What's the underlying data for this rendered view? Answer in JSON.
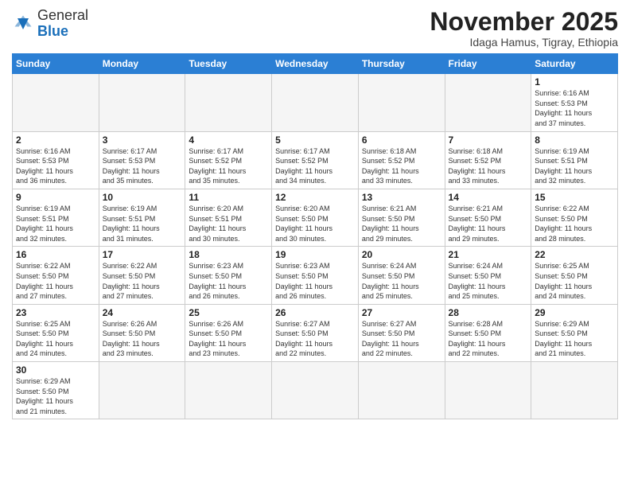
{
  "header": {
    "logo_general": "General",
    "logo_blue": "Blue",
    "month_title": "November 2025",
    "location": "Idaga Hamus, Tigray, Ethiopia"
  },
  "days_of_week": [
    "Sunday",
    "Monday",
    "Tuesday",
    "Wednesday",
    "Thursday",
    "Friday",
    "Saturday"
  ],
  "weeks": [
    [
      {
        "day": "",
        "info": ""
      },
      {
        "day": "",
        "info": ""
      },
      {
        "day": "",
        "info": ""
      },
      {
        "day": "",
        "info": ""
      },
      {
        "day": "",
        "info": ""
      },
      {
        "day": "",
        "info": ""
      },
      {
        "day": "1",
        "info": "Sunrise: 6:16 AM\nSunset: 5:53 PM\nDaylight: 11 hours\nand 37 minutes."
      }
    ],
    [
      {
        "day": "2",
        "info": "Sunrise: 6:16 AM\nSunset: 5:53 PM\nDaylight: 11 hours\nand 36 minutes."
      },
      {
        "day": "3",
        "info": "Sunrise: 6:17 AM\nSunset: 5:53 PM\nDaylight: 11 hours\nand 35 minutes."
      },
      {
        "day": "4",
        "info": "Sunrise: 6:17 AM\nSunset: 5:52 PM\nDaylight: 11 hours\nand 35 minutes."
      },
      {
        "day": "5",
        "info": "Sunrise: 6:17 AM\nSunset: 5:52 PM\nDaylight: 11 hours\nand 34 minutes."
      },
      {
        "day": "6",
        "info": "Sunrise: 6:18 AM\nSunset: 5:52 PM\nDaylight: 11 hours\nand 33 minutes."
      },
      {
        "day": "7",
        "info": "Sunrise: 6:18 AM\nSunset: 5:52 PM\nDaylight: 11 hours\nand 33 minutes."
      },
      {
        "day": "8",
        "info": "Sunrise: 6:19 AM\nSunset: 5:51 PM\nDaylight: 11 hours\nand 32 minutes."
      }
    ],
    [
      {
        "day": "9",
        "info": "Sunrise: 6:19 AM\nSunset: 5:51 PM\nDaylight: 11 hours\nand 32 minutes."
      },
      {
        "day": "10",
        "info": "Sunrise: 6:19 AM\nSunset: 5:51 PM\nDaylight: 11 hours\nand 31 minutes."
      },
      {
        "day": "11",
        "info": "Sunrise: 6:20 AM\nSunset: 5:51 PM\nDaylight: 11 hours\nand 30 minutes."
      },
      {
        "day": "12",
        "info": "Sunrise: 6:20 AM\nSunset: 5:50 PM\nDaylight: 11 hours\nand 30 minutes."
      },
      {
        "day": "13",
        "info": "Sunrise: 6:21 AM\nSunset: 5:50 PM\nDaylight: 11 hours\nand 29 minutes."
      },
      {
        "day": "14",
        "info": "Sunrise: 6:21 AM\nSunset: 5:50 PM\nDaylight: 11 hours\nand 29 minutes."
      },
      {
        "day": "15",
        "info": "Sunrise: 6:22 AM\nSunset: 5:50 PM\nDaylight: 11 hours\nand 28 minutes."
      }
    ],
    [
      {
        "day": "16",
        "info": "Sunrise: 6:22 AM\nSunset: 5:50 PM\nDaylight: 11 hours\nand 27 minutes."
      },
      {
        "day": "17",
        "info": "Sunrise: 6:22 AM\nSunset: 5:50 PM\nDaylight: 11 hours\nand 27 minutes."
      },
      {
        "day": "18",
        "info": "Sunrise: 6:23 AM\nSunset: 5:50 PM\nDaylight: 11 hours\nand 26 minutes."
      },
      {
        "day": "19",
        "info": "Sunrise: 6:23 AM\nSunset: 5:50 PM\nDaylight: 11 hours\nand 26 minutes."
      },
      {
        "day": "20",
        "info": "Sunrise: 6:24 AM\nSunset: 5:50 PM\nDaylight: 11 hours\nand 25 minutes."
      },
      {
        "day": "21",
        "info": "Sunrise: 6:24 AM\nSunset: 5:50 PM\nDaylight: 11 hours\nand 25 minutes."
      },
      {
        "day": "22",
        "info": "Sunrise: 6:25 AM\nSunset: 5:50 PM\nDaylight: 11 hours\nand 24 minutes."
      }
    ],
    [
      {
        "day": "23",
        "info": "Sunrise: 6:25 AM\nSunset: 5:50 PM\nDaylight: 11 hours\nand 24 minutes."
      },
      {
        "day": "24",
        "info": "Sunrise: 6:26 AM\nSunset: 5:50 PM\nDaylight: 11 hours\nand 23 minutes."
      },
      {
        "day": "25",
        "info": "Sunrise: 6:26 AM\nSunset: 5:50 PM\nDaylight: 11 hours\nand 23 minutes."
      },
      {
        "day": "26",
        "info": "Sunrise: 6:27 AM\nSunset: 5:50 PM\nDaylight: 11 hours\nand 22 minutes."
      },
      {
        "day": "27",
        "info": "Sunrise: 6:27 AM\nSunset: 5:50 PM\nDaylight: 11 hours\nand 22 minutes."
      },
      {
        "day": "28",
        "info": "Sunrise: 6:28 AM\nSunset: 5:50 PM\nDaylight: 11 hours\nand 22 minutes."
      },
      {
        "day": "29",
        "info": "Sunrise: 6:29 AM\nSunset: 5:50 PM\nDaylight: 11 hours\nand 21 minutes."
      }
    ],
    [
      {
        "day": "30",
        "info": "Sunrise: 6:29 AM\nSunset: 5:50 PM\nDaylight: 11 hours\nand 21 minutes."
      },
      {
        "day": "",
        "info": ""
      },
      {
        "day": "",
        "info": ""
      },
      {
        "day": "",
        "info": ""
      },
      {
        "day": "",
        "info": ""
      },
      {
        "day": "",
        "info": ""
      },
      {
        "day": "",
        "info": ""
      }
    ]
  ]
}
